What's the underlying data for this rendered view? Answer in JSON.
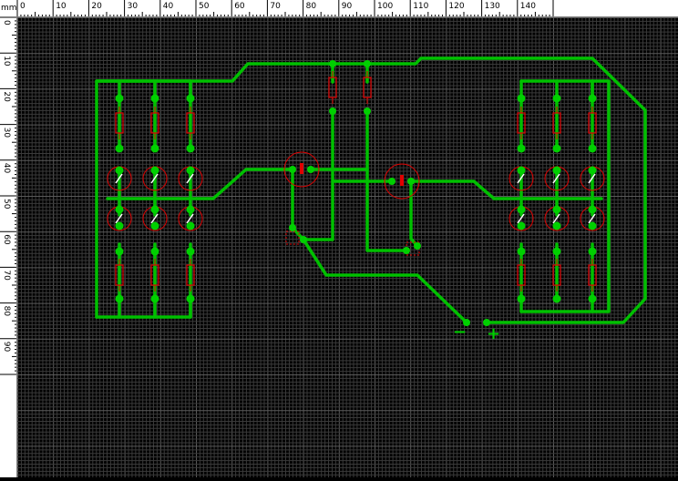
{
  "units_label": "mm",
  "ruler_x_labels": [
    "0",
    "10",
    "20",
    "30",
    "40",
    "50",
    "60",
    "70",
    "80",
    "90",
    "100",
    "110",
    "120",
    "130",
    "140"
  ],
  "ruler_y_labels": [
    "0",
    "10",
    "20",
    "30",
    "40",
    "50",
    "60",
    "70",
    "80",
    "90"
  ],
  "colors": {
    "background": "#000000",
    "grid_minor": "#3a3a3a",
    "grid_major": "#5a5a5a",
    "track": "#00c000",
    "pad": "#00d000",
    "component": "#e00000",
    "ruler_bg": "#ffffff",
    "ruler_text": "#000000"
  },
  "board": {
    "polarity_minus": "−",
    "polarity_plus": "+"
  }
}
